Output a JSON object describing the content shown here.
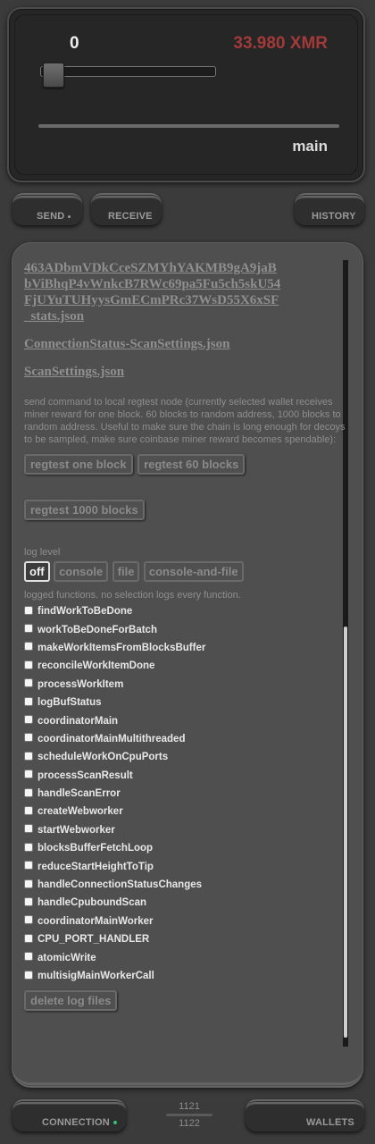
{
  "wallet": {
    "amount_left": "0",
    "amount_right": "33.980 XMR",
    "wallet_name": "main",
    "slider_value": 0
  },
  "tabs": {
    "send": "SEND",
    "receive": "RECEIVE",
    "history": "HISTORY"
  },
  "panel": {
    "address_link": "463ADbmVDkCceSZMYhYAKMB9gA9jaBbViBhqP4vWnkcB7RWc69pa5Fu5ch5skU54FjUYuTUHyysGmECmPRc37WsD55X6xSF_stats.json",
    "connection_link": "ConnectionStatus-ScanSettings.json",
    "scan_link": "ScanSettings.json",
    "regtest_help": "send command to local regtest node (currently selected wallet receives miner reward for one block. 60 blocks to random address, 1000 blocks to random address. Useful to make sure the chain is long enough for decoys to be sampled, make sure coinbase miner reward becomes spendable):",
    "regtest_one": "regtest one block",
    "regtest_60": "regtest 60 blocks",
    "regtest_1000": "regtest 1000 blocks",
    "log_level_label": "log level",
    "log_levels": [
      "off",
      "console",
      "file",
      "console-and-file"
    ],
    "log_level_selected": "off",
    "logged_functions_label": "logged functions. no selection logs every function.",
    "functions": [
      "findWorkToBeDone",
      "workToBeDoneForBatch",
      "makeWorkItemsFromBlocksBuffer",
      "reconcileWorkItemDone",
      "processWorkItem",
      "logBufStatus",
      "coordinatorMain",
      "coordinatorMainMultithreaded",
      "scheduleWorkOnCpuPorts",
      "processScanResult",
      "handleScanError",
      "createWebworker",
      "startWebworker",
      "blocksBufferFetchLoop",
      "reduceStartHeightToTip",
      "handleConnectionStatusChanges",
      "handleCpuboundScan",
      "coordinatorMainWorker",
      "CPU_PORT_HANDLER",
      "atomicWrite",
      "multisigMainWorkerCall"
    ],
    "delete_logs": "delete log files"
  },
  "bottom": {
    "connection": "CONNECTION",
    "wallets": "WALLETS",
    "block_top": "1121",
    "block_bottom": "1122"
  },
  "colors": {
    "balance": "#a33a3a",
    "connection_dot": "#2fc36a"
  }
}
